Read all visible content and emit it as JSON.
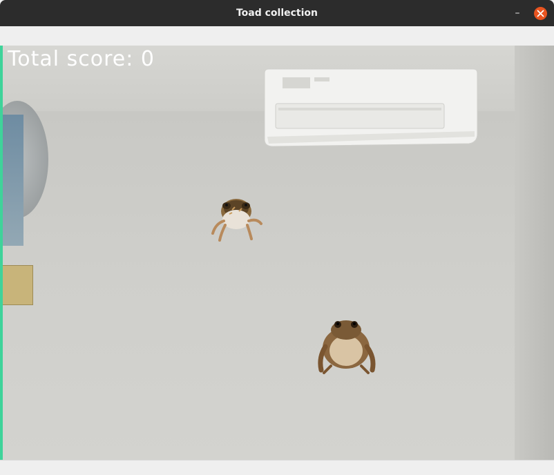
{
  "window": {
    "title": "Toad collection",
    "minimize_glyph": "–",
    "close_color": "#e95420"
  },
  "game": {
    "score_label": "Total score: 0",
    "score_value": 0,
    "toads": [
      {
        "name": "toad",
        "icon": "toad-icon"
      },
      {
        "name": "toad",
        "icon": "toad-icon"
      }
    ]
  }
}
